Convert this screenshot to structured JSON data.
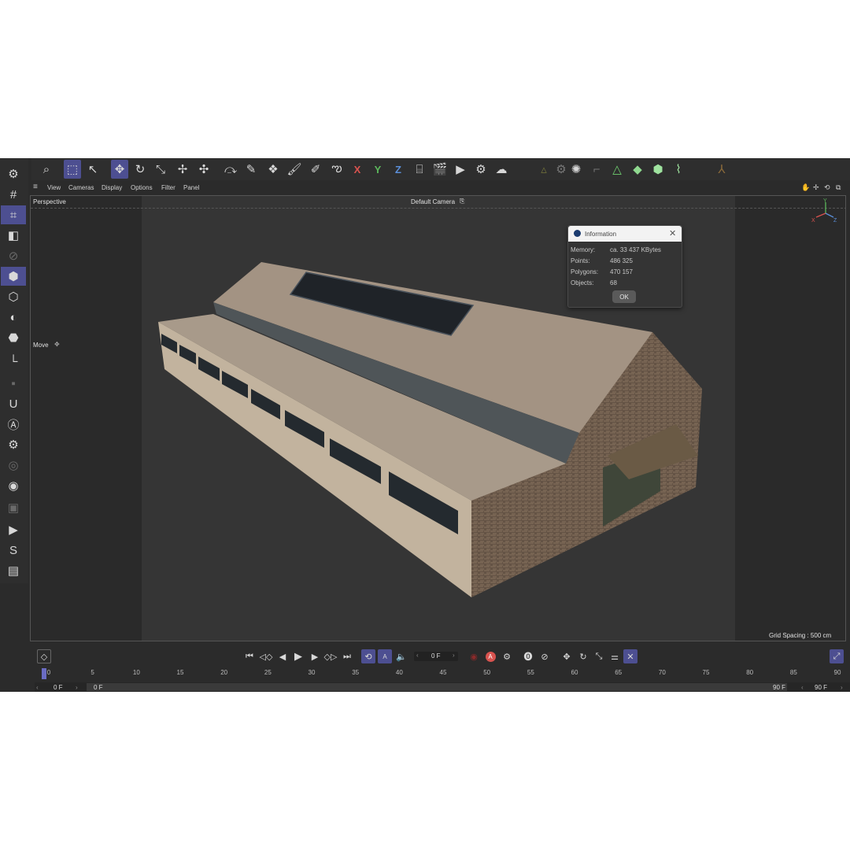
{
  "menu": {
    "view": "View",
    "cameras": "Cameras",
    "display": "Display",
    "options": "Options",
    "filter": "Filter",
    "panel": "Panel"
  },
  "viewport": {
    "name": "Perspective",
    "camera": "Default Camera",
    "tool_label": "Move",
    "grid_spacing": "Grid Spacing : 500 cm",
    "axis": {
      "x": "X",
      "y": "Y",
      "z": "Z"
    }
  },
  "info_dialog": {
    "title": "Information",
    "rows": [
      {
        "key": "Memory:",
        "value": "ca. 33 437 KBytes"
      },
      {
        "key": "Points:",
        "value": "486 325"
      },
      {
        "key": "Polygons:",
        "value": "470 157"
      },
      {
        "key": "Objects:",
        "value": "68"
      }
    ],
    "ok_label": "OK"
  },
  "toolbar": {
    "x_label": "X",
    "y_label": "Y",
    "z_label": "Z"
  },
  "timeline": {
    "current_frame": "0 F",
    "ticks": [
      "0",
      "5",
      "10",
      "15",
      "20",
      "25",
      "30",
      "35",
      "40",
      "45",
      "50",
      "55",
      "60",
      "65",
      "70",
      "75",
      "80",
      "85",
      "90"
    ],
    "range_start": "0 F",
    "range_left": "0 F",
    "range_right": "90 F",
    "range_end": "90 F"
  },
  "colors": {
    "accent": "#4d4f91",
    "x_axis": "#d9534f",
    "y_axis": "#5cb85c",
    "z_axis": "#5b8fd9"
  }
}
